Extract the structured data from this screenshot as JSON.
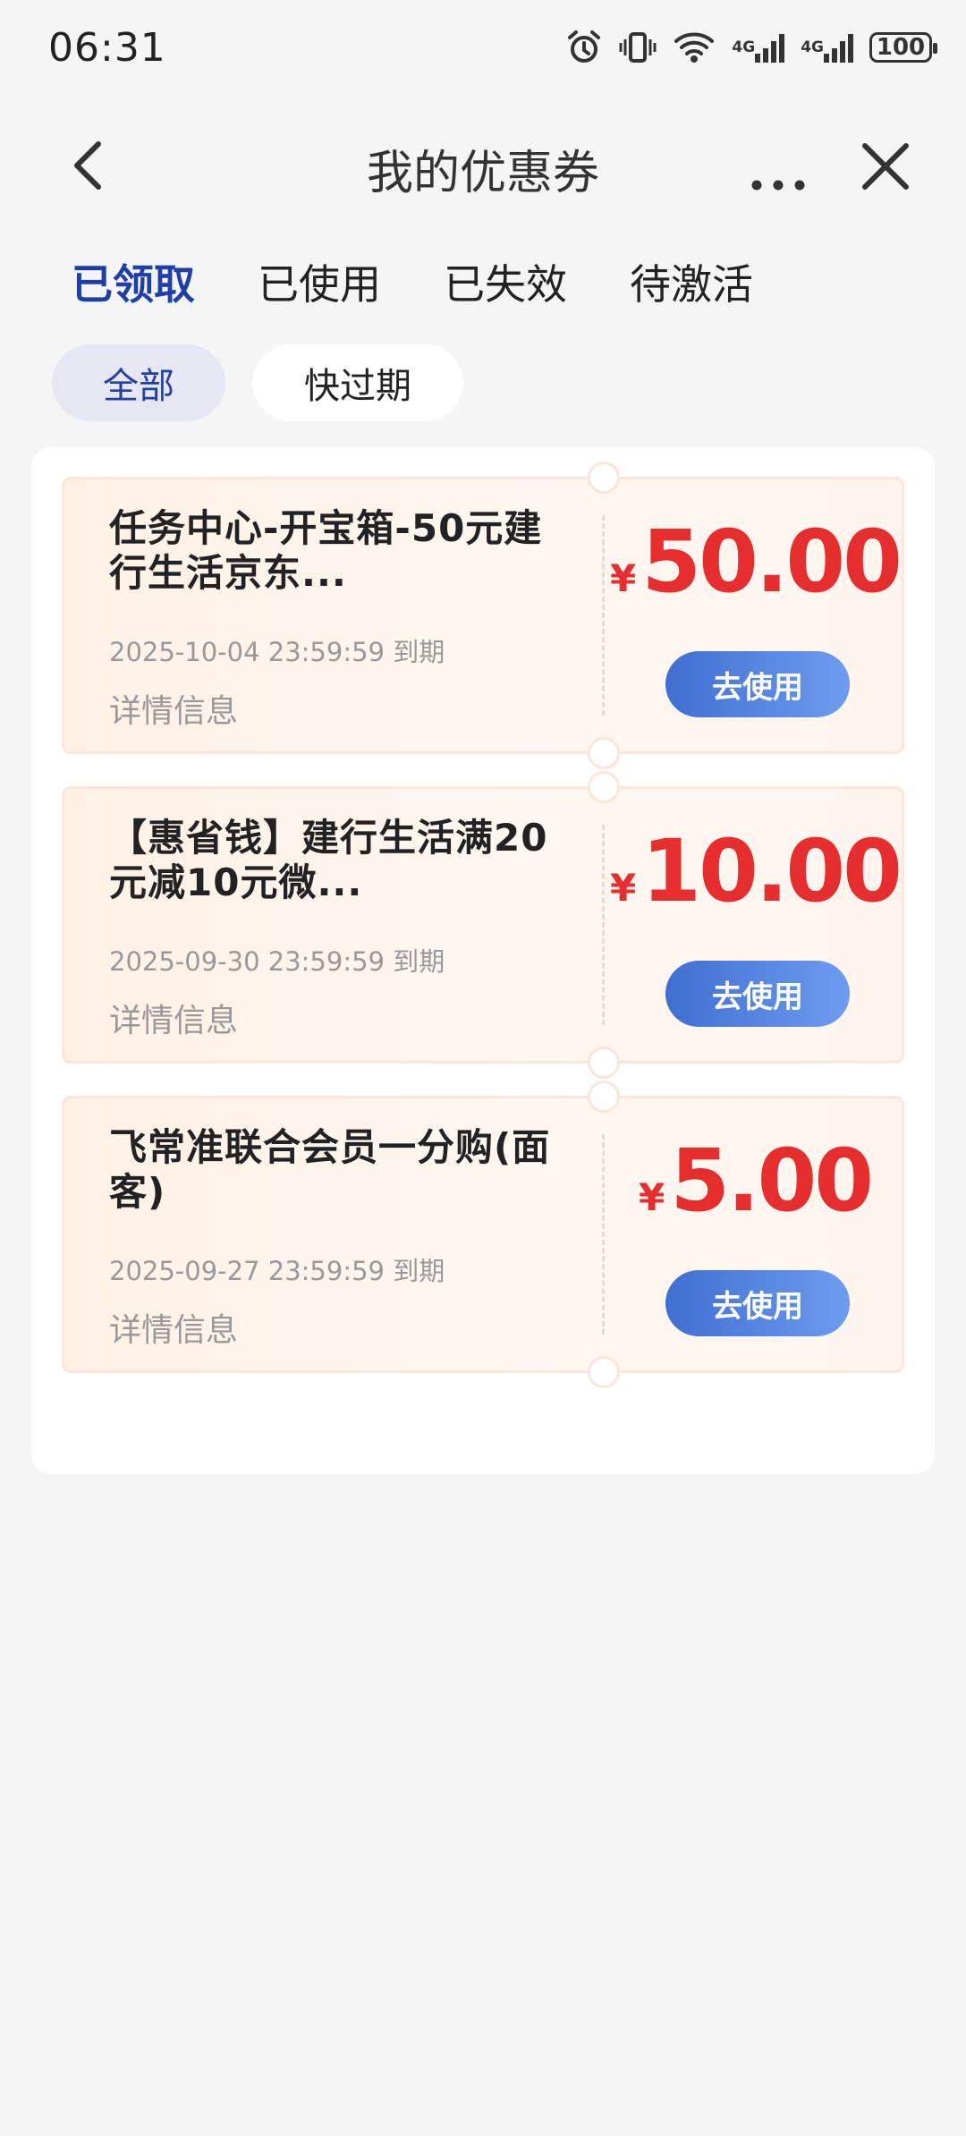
{
  "status_bar": {
    "time": "06:31",
    "network_1": "4G",
    "network_2": "4G",
    "battery": "100",
    "icons": [
      "alarm-icon",
      "vibrate-icon",
      "wifi-icon",
      "signal-icon",
      "signal-icon",
      "battery-icon"
    ]
  },
  "nav": {
    "title": "我的优惠券",
    "icons": [
      "back-icon",
      "more-icon",
      "close-icon"
    ]
  },
  "tabs": [
    {
      "label": "已领取",
      "active": true
    },
    {
      "label": "已使用",
      "active": false
    },
    {
      "label": "已失效",
      "active": false
    },
    {
      "label": "待激活",
      "active": false
    }
  ],
  "filters": [
    {
      "label": "全部",
      "active": true
    },
    {
      "label": "快过期",
      "active": false
    }
  ],
  "coupons": [
    {
      "title": "任务中心-开宝箱-50元建行生活京东...",
      "expire": "2025-10-04 23:59:59 到期",
      "detail": "详情信息",
      "currency": "¥",
      "amount": "50.00",
      "button": "去使用"
    },
    {
      "title": "【惠省钱】建行生活满20元减10元微...",
      "expire": "2025-09-30 23:59:59 到期",
      "detail": "详情信息",
      "currency": "¥",
      "amount": "10.00",
      "button": "去使用"
    },
    {
      "title": "飞常准联合会员一分购(面客)",
      "expire": "2025-09-27 23:59:59 到期",
      "detail": "详情信息",
      "currency": "¥",
      "amount": "5.00",
      "button": "去使用"
    }
  ],
  "colors": {
    "accent": "#1f3ea8",
    "amount": "#e62e2e",
    "button_start": "#3f6fd1",
    "button_end": "#6e9cf0",
    "coupon_bg": "#fff3ea"
  }
}
